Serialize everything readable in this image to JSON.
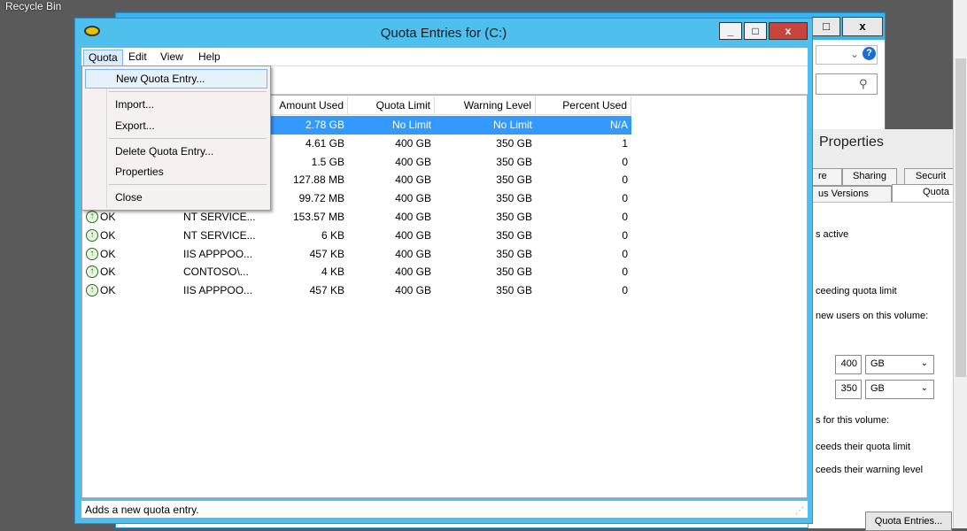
{
  "desktop": {
    "recycle_bin_label": "Recycle Bin"
  },
  "explorer": {
    "close_symbol": "x",
    "maximize_symbol": "□",
    "help_icon": "help-icon",
    "search_icon": "search-icon"
  },
  "properties": {
    "title": "Properties",
    "tabs": [
      "re",
      "Sharing",
      "Securit",
      "us Versions",
      "Quota"
    ],
    "lines": [
      "s active",
      "ceeding quota limit",
      "new users on this volume:",
      "s for this volume:",
      "ceeds their quota limit",
      "ceeds their warning level"
    ],
    "limit_value": "400",
    "limit_unit": "GB",
    "warning_value": "350",
    "warning_unit": "GB",
    "quota_entries_button": "Quota Entries..."
  },
  "quota_window": {
    "title": "Quota Entries for  (C:)",
    "minimize_symbol": "_",
    "maximize_symbol": "□",
    "close_symbol": "x",
    "menus": [
      "Quota",
      "Edit",
      "View",
      "Help"
    ],
    "columns": [
      "Amount Used",
      "Quota Limit",
      "Warning Level",
      "Percent Used"
    ],
    "rows": [
      {
        "status": "",
        "name": "",
        "amount": "2.78 GB",
        "limit": "No Limit",
        "warning": "No Limit",
        "percent": "N/A",
        "selected": true
      },
      {
        "status": "",
        "name": "",
        "amount": "4.61 GB",
        "limit": "400 GB",
        "warning": "350 GB",
        "percent": "1"
      },
      {
        "status": "",
        "name": "",
        "amount": "1.5 GB",
        "limit": "400 GB",
        "warning": "350 GB",
        "percent": "0"
      },
      {
        "status": "",
        "name": "",
        "amount": "127.88 MB",
        "limit": "400 GB",
        "warning": "350 GB",
        "percent": "0"
      },
      {
        "status": "",
        "name": "",
        "amount": "99.72 MB",
        "limit": "400 GB",
        "warning": "350 GB",
        "percent": "0"
      },
      {
        "status": "OK",
        "name": "NT SERVICE...",
        "amount": "153.57 MB",
        "limit": "400 GB",
        "warning": "350 GB",
        "percent": "0"
      },
      {
        "status": "OK",
        "name": "NT SERVICE...",
        "amount": "6 KB",
        "limit": "400 GB",
        "warning": "350 GB",
        "percent": "0"
      },
      {
        "status": "OK",
        "name": "IIS APPPOO...",
        "amount": "457 KB",
        "limit": "400 GB",
        "warning": "350 GB",
        "percent": "0"
      },
      {
        "status": "OK",
        "name": "CONTOSO\\...",
        "amount": "4 KB",
        "limit": "400 GB",
        "warning": "350 GB",
        "percent": "0"
      },
      {
        "status": "OK",
        "name": "IIS APPPOO...",
        "amount": "457 KB",
        "limit": "400 GB",
        "warning": "350 GB",
        "percent": "0"
      }
    ],
    "status_bar": "Adds a new quota entry."
  },
  "quota_menu": {
    "items": [
      "New Quota Entry...",
      "Import...",
      "Export...",
      "Delete Quota Entry...",
      "Properties",
      "Close"
    ]
  },
  "colors": {
    "title_bar": "#4fc0ee",
    "selection": "#3399ff",
    "close_button": "#c9453b"
  }
}
